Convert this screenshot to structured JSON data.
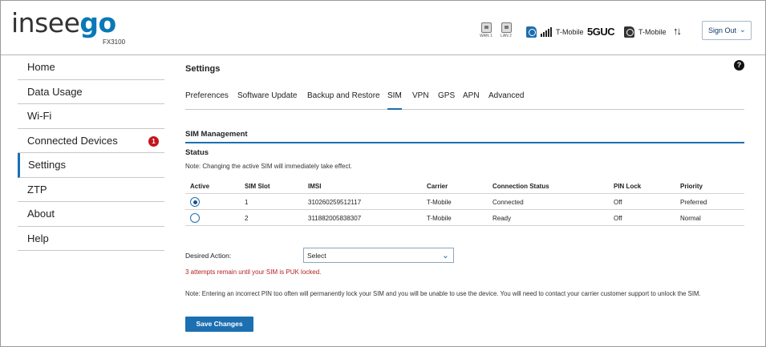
{
  "header": {
    "logo_prefix": "insee",
    "logo_suffix": "go",
    "model": "FX3100",
    "ports": [
      {
        "label": "WAN 1"
      },
      {
        "label": "LAN 2"
      }
    ],
    "carrier_primary": "T-Mobile",
    "network_tech": "5GUC",
    "carrier_secondary": "T-Mobile",
    "data_arrows": "↑↓",
    "sign_out_label": "Sign Out",
    "signal_bars": 5,
    "brand_color": "#1c6fb1"
  },
  "sidebar": {
    "items": [
      {
        "label": "Home"
      },
      {
        "label": "Data Usage"
      },
      {
        "label": "Wi-Fi"
      },
      {
        "label": "Connected Devices",
        "badge": "1"
      },
      {
        "label": "Settings",
        "active": true
      },
      {
        "label": "ZTP"
      },
      {
        "label": "About"
      },
      {
        "label": "Help"
      }
    ]
  },
  "main": {
    "title": "Settings",
    "help": "?",
    "tabs": [
      {
        "label": "Preferences"
      },
      {
        "label": "Software Update"
      },
      {
        "label": "Backup and Restore"
      },
      {
        "label": "SIM",
        "active": true
      },
      {
        "label": "VPN"
      },
      {
        "label": "GPS"
      },
      {
        "label": "APN"
      },
      {
        "label": "Advanced"
      }
    ],
    "section_title": "SIM Management",
    "status_title": "Status",
    "status_note": "Note: Changing the active SIM will immediately take effect.",
    "table": {
      "headers": [
        "Active",
        "SIM Slot",
        "IMSI",
        "Carrier",
        "Connection Status",
        "PIN Lock",
        "Priority"
      ],
      "rows": [
        {
          "active": true,
          "slot": "1",
          "imsi": "310260259512117",
          "carrier": "T-Mobile",
          "status": "Connected",
          "pin_lock": "Off",
          "priority": "Preferred"
        },
        {
          "active": false,
          "slot": "2",
          "imsi": "311882005838307",
          "carrier": "T-Mobile",
          "status": "Ready",
          "pin_lock": "Off",
          "priority": "Normal"
        }
      ]
    },
    "desired_action_label": "Desired Action:",
    "desired_action_value": "Select",
    "puk_warning": "3 attempts remain until your SIM is PUK locked.",
    "pin_note": "Note: Entering an incorrect PIN too often will permanently lock your SIM and you will be unable to use the device. You will need to contact your carrier customer support to unlock the SIM.",
    "save_label": "Save Changes"
  }
}
